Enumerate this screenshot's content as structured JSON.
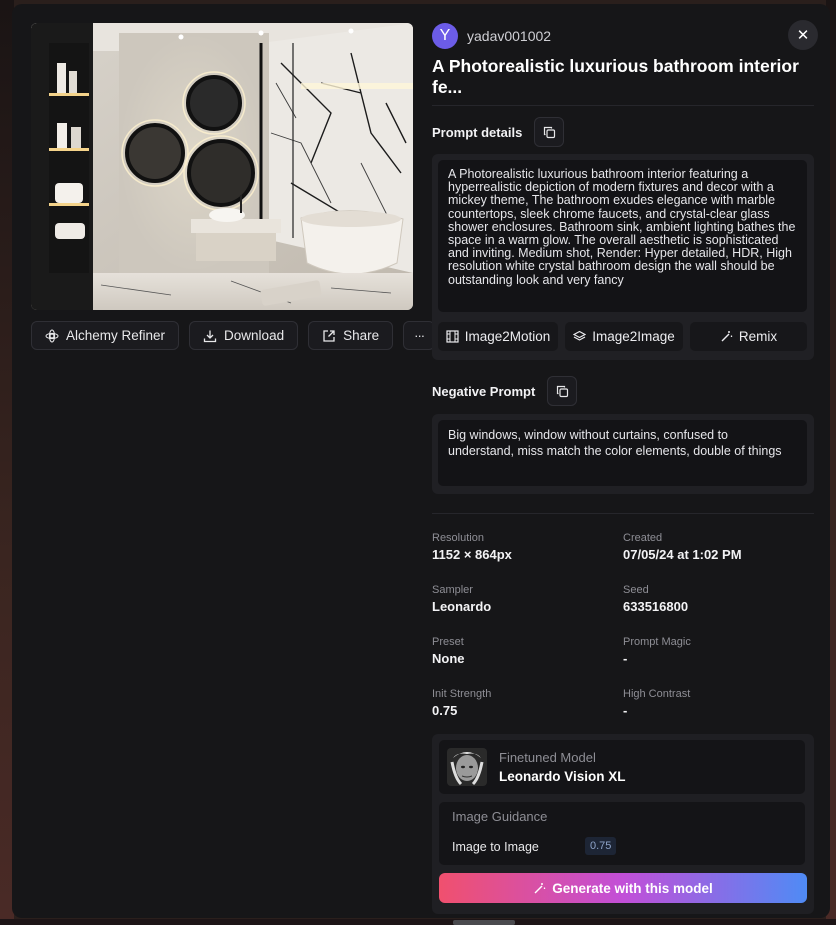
{
  "user": {
    "initial": "Y",
    "name": "yadav001002"
  },
  "title": "A Photorealistic luxurious bathroom interior fe...",
  "actions": {
    "alchemy": "Alchemy Refiner",
    "download": "Download",
    "share": "Share",
    "more": "···"
  },
  "close_glyph": "✕",
  "prompt": {
    "heading": "Prompt details",
    "text": "A Photorealistic luxurious bathroom interior featuring a hyperrealistic depiction of modern fixtures and decor with a mickey theme, The bathroom exudes elegance with marble countertops, sleek chrome faucets, and crystal-clear glass shower enclosures. Bathroom sink, ambient lighting bathes the space in a warm glow. The overall aesthetic is sophisticated and inviting. Medium shot, Render: Hyper detailed, HDR, High resolution white crystal bathroom design the wall should be outstanding look and very fancy",
    "buttons": {
      "motion": "Image2Motion",
      "image": "Image2Image",
      "remix": "Remix"
    }
  },
  "negative": {
    "heading": "Negative Prompt",
    "text": "Big windows, window without curtains, confused to understand, miss match the color elements, double of things"
  },
  "meta": {
    "resolution_label": "Resolution",
    "resolution": "1152 × 864px",
    "created_label": "Created",
    "created": "07/05/24 at 1:02 PM",
    "sampler_label": "Sampler",
    "sampler": "Leonardo",
    "seed_label": "Seed",
    "seed": "633516800",
    "preset_label": "Preset",
    "preset": "None",
    "magic_label": "Prompt Magic",
    "magic": "-",
    "init_label": "Init Strength",
    "init": "0.75",
    "contrast_label": "High Contrast",
    "contrast": "-"
  },
  "model": {
    "label": "Finetuned Model",
    "name": "Leonardo Vision XL",
    "guidance_title": "Image Guidance",
    "guidance_label": "Image to Image",
    "guidance_value": "0.75",
    "generate": "Generate with this model"
  },
  "colors": {
    "accent": "#6c5ce7",
    "gradient_start": "#f0506e",
    "gradient_end": "#4f8bf5"
  },
  "icons": [
    "alchemy-icon",
    "download-icon",
    "share-icon",
    "copy-icon",
    "motion-icon",
    "layers-icon",
    "wand-icon",
    "close-icon"
  ]
}
